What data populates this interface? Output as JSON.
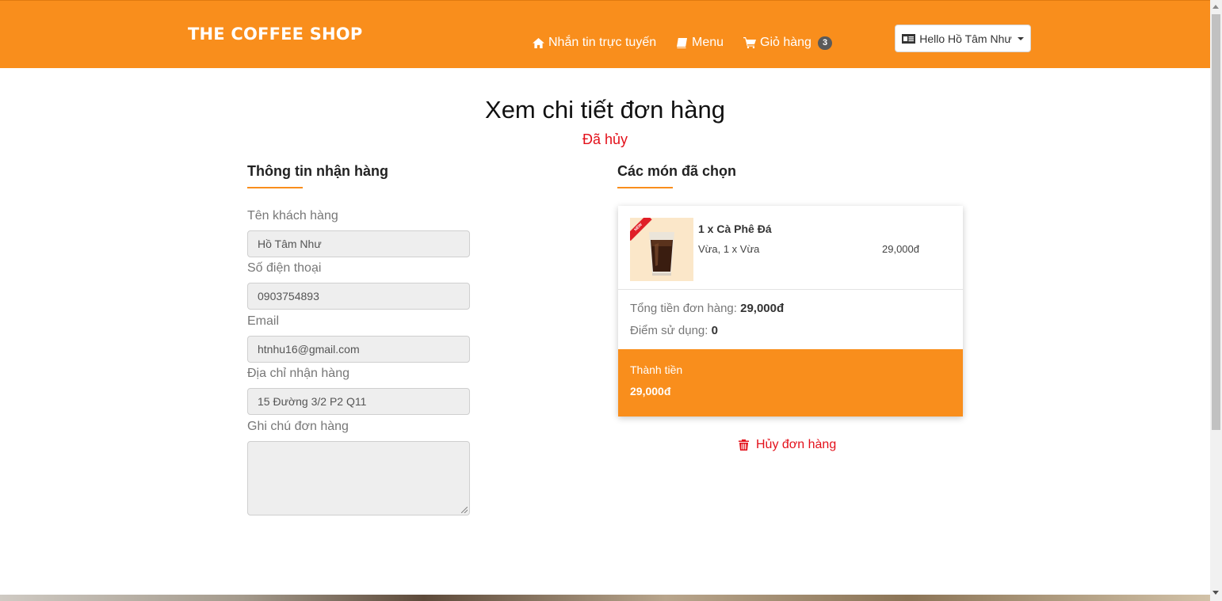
{
  "header": {
    "brand": "THE COFFEE SHOP",
    "nav": {
      "chat": "Nhắn tin trực tuyến",
      "menu": "Menu",
      "cart": "Giỏ hàng",
      "cart_count": "3"
    },
    "user_greeting": "Hello Hồ Tâm Như"
  },
  "page": {
    "title": "Xem chi tiết đơn hàng",
    "status": "Đã hủy"
  },
  "customer_info": {
    "section_title": "Thông tin nhận hàng",
    "fields": {
      "name_label": "Tên khách hàng",
      "name_value": "Hồ Tâm Như",
      "phone_label": "Số điện thoại",
      "phone_value": "0903754893",
      "email_label": "Email",
      "email_value": "htnhu16@gmail.com",
      "address_label": "Địa chỉ nhận hàng",
      "address_value": "15 Đường 3/2 P2 Q11",
      "note_label": "Ghi chú đơn hàng",
      "note_value": ""
    }
  },
  "order": {
    "section_title": "Các món đã chọn",
    "items": [
      {
        "badge": "NEW",
        "name": "1 x Cà Phê Đá",
        "options": "Vừa, 1 x Vừa",
        "price": "29,000đ"
      }
    ],
    "total_label": "Tổng tiền đơn hàng:",
    "total_value": "29,000đ",
    "points_label": "Điểm sử dụng:",
    "points_value": "0",
    "final_label": "Thành tiền",
    "final_value": "29,000đ",
    "cancel_label": "Hủy đơn hàng"
  },
  "colors": {
    "accent": "#f98e1c",
    "danger": "#e3101a"
  }
}
